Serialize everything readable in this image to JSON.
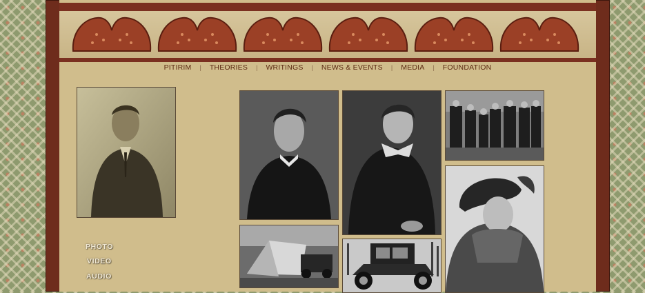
{
  "nav": {
    "items": [
      {
        "label": "PITIRIM"
      },
      {
        "label": "THEORIES"
      },
      {
        "label": "WRITINGS"
      },
      {
        "label": "NEWS & EVENTS"
      },
      {
        "label": "MEDIA"
      },
      {
        "label": "FOUNDATION"
      }
    ],
    "separator": "|"
  },
  "sidebar": {
    "links": [
      {
        "label": "PHOTO"
      },
      {
        "label": "VIDEO"
      },
      {
        "label": "AUDIO"
      }
    ]
  },
  "colors": {
    "frame": "#6e2c1c",
    "panel": "#d0bd8c",
    "nav_text": "#5b2a12"
  }
}
